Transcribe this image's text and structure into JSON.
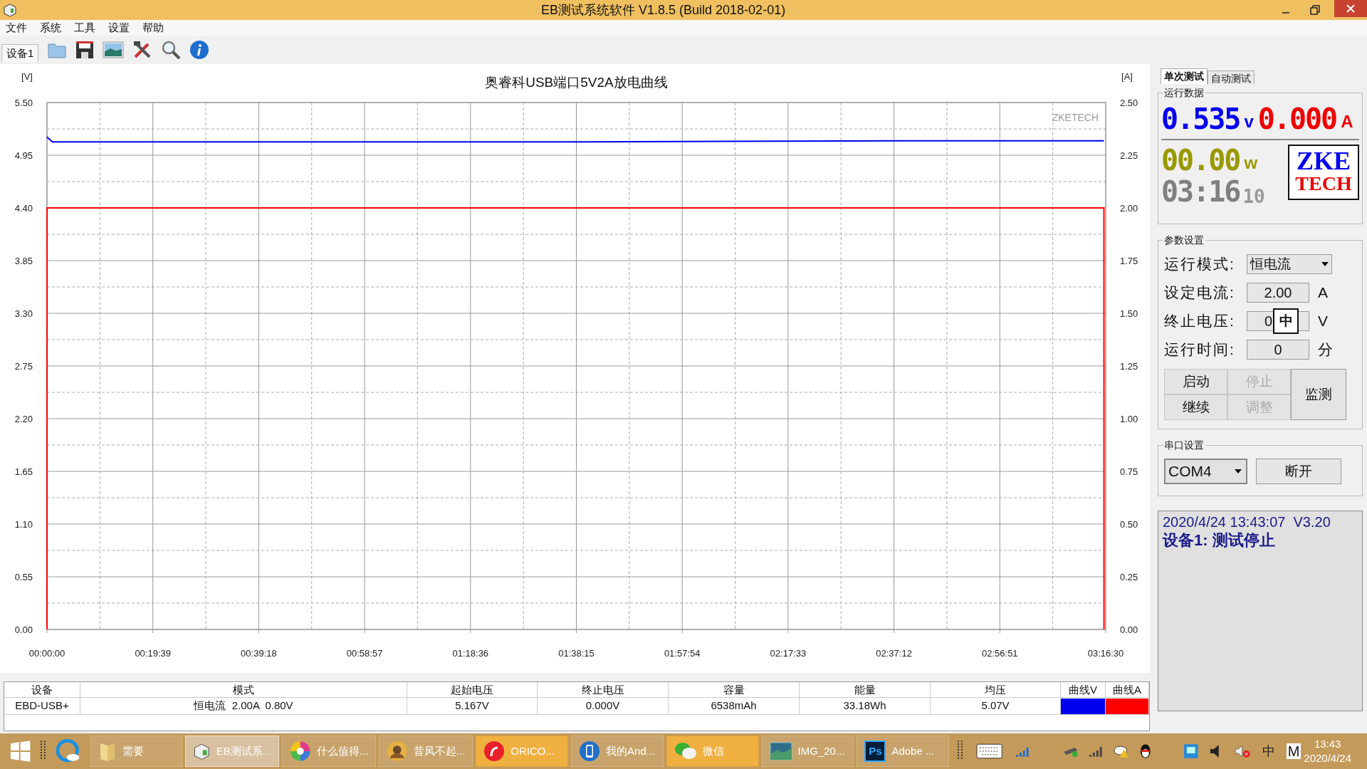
{
  "window": {
    "title": "EB测试系统软件 V1.8.5 (Build 2018-02-01)"
  },
  "menu": [
    "文件",
    "系统",
    "工具",
    "设置",
    "帮助"
  ],
  "toolbar": {
    "device_tab": "设备1",
    "tools": [
      {
        "kind": "folder"
      },
      {
        "kind": "save"
      },
      {
        "kind": "image"
      },
      {
        "kind": "tools"
      },
      {
        "kind": "search"
      },
      {
        "kind": "info"
      }
    ]
  },
  "chart_data": {
    "type": "line",
    "grid": true,
    "title": "奥睿科USB端口5V2A放电曲线",
    "ylabel": "[V]",
    "y2label": "[A]",
    "annotations": [
      "ZKETECH"
    ],
    "x": [
      0,
      1,
      60,
      300,
      6000,
      9500,
      11760,
      11770,
      11771
    ],
    "xlim": [
      0,
      11790
    ],
    "ylim": [
      0,
      5.5
    ],
    "y2lim": [
      0,
      2.5
    ],
    "xticks": [
      {
        "value": 0,
        "label": "00:00:00"
      },
      {
        "value": 1179,
        "label": "00:19:39"
      },
      {
        "value": 2358,
        "label": "00:39:18"
      },
      {
        "value": 3537,
        "label": "00:58:57"
      },
      {
        "value": 4716,
        "label": "01:18:36"
      },
      {
        "value": 5895,
        "label": "01:38:15"
      },
      {
        "value": 7074,
        "label": "01:57:54"
      },
      {
        "value": 8253,
        "label": "02:17:33"
      },
      {
        "value": 9432,
        "label": "02:37:12"
      },
      {
        "value": 10611,
        "label": "02:56:51"
      },
      {
        "value": 11790,
        "label": "03:16:30"
      }
    ],
    "yticks": [
      {
        "value": 0,
        "label": "0.00"
      },
      {
        "value": 0.55,
        "label": "0.55"
      },
      {
        "value": 1.1,
        "label": "1.10"
      },
      {
        "value": 1.65,
        "label": "1.65"
      },
      {
        "value": 2.2,
        "label": "2.20"
      },
      {
        "value": 2.75,
        "label": "2.75"
      },
      {
        "value": 3.3,
        "label": "3.30"
      },
      {
        "value": 3.85,
        "label": "3.85"
      },
      {
        "value": 4.4,
        "label": "4.40"
      },
      {
        "value": 4.95,
        "label": "4.95"
      },
      {
        "value": 5.5,
        "label": "5.50"
      }
    ],
    "y2ticks": [
      {
        "value": 0,
        "label": "0.00"
      },
      {
        "value": 0.25,
        "label": "0.25"
      },
      {
        "value": 0.5,
        "label": "0.50"
      },
      {
        "value": 0.75,
        "label": "0.75"
      },
      {
        "value": 1,
        "label": "1.00"
      },
      {
        "value": 1.25,
        "label": "1.25"
      },
      {
        "value": 1.5,
        "label": "1.50"
      },
      {
        "value": 1.75,
        "label": "1.75"
      },
      {
        "value": 2,
        "label": "2.00"
      },
      {
        "value": 2.25,
        "label": "2.25"
      },
      {
        "value": 2.5,
        "label": "2.50"
      }
    ],
    "series": [
      {
        "color": "#0000ee",
        "axis": "y",
        "values": [
          5.14,
          5.14,
          5.09,
          5.09,
          5.09,
          5.1,
          5.1,
          5.1,
          null
        ]
      },
      {
        "color": "#ff0000",
        "axis": "y2",
        "values": [
          0,
          2,
          2,
          2,
          2,
          2,
          2,
          2,
          0
        ]
      }
    ]
  },
  "side_tabs": [
    {
      "label": "单次测试",
      "selected": true
    },
    {
      "label": "自动测试",
      "selected": false
    }
  ],
  "run_data": {
    "title": "运行数据",
    "voltage": "0.535",
    "voltage_unit": "v",
    "current": "0.000",
    "current_unit": "A",
    "power": "00.00",
    "power_unit": "w",
    "time": "03:16",
    "seconds": "10",
    "logo_top": "ZKE",
    "logo_bottom": "TECH"
  },
  "params": {
    "title": "参数设置",
    "ime_indicator": "中",
    "rows": [
      {
        "label": "运行模式:",
        "value": "恒电流",
        "kind": "select"
      },
      {
        "label": "设定电流:",
        "value": "2.00",
        "unit": "A",
        "kind": "input"
      },
      {
        "label": "终止电压:",
        "value": "0",
        "unit": "V",
        "kind": "input"
      },
      {
        "label": "运行时间:",
        "value": "0",
        "unit": "分",
        "kind": "input"
      }
    ]
  },
  "buttons": [
    {
      "label": "启动",
      "disabled": false
    },
    {
      "label": "停止",
      "disabled": true
    },
    {
      "label": "继续",
      "disabled": false
    },
    {
      "label": "调整",
      "disabled": true
    }
  ],
  "monitor_button": "监测",
  "serial": {
    "title": "串口设置",
    "port": "COM4",
    "button": "断开"
  },
  "log": [
    "2020/4/24 13:43:07  V3.20",
    "设备1: 测试停止"
  ],
  "table": {
    "columns": [
      "设备",
      "模式",
      "起始电压",
      "终止电压",
      "容量",
      "能量",
      "均压",
      "曲线V",
      "曲线A"
    ],
    "rows": [
      {
        "cells": [
          "EBD-USB+",
          "恒电流  2.00A  0.80V",
          "5.167V",
          "0.000V",
          "6538mAh",
          "33.18Wh",
          "5.07V"
        ],
        "swatches": [
          {
            "color": "#0000ee"
          },
          {
            "color": "#ff0000"
          }
        ]
      }
    ]
  },
  "taskbar": {
    "apps": [
      {
        "label": "需要",
        "kind": "folder",
        "selected": false,
        "flashing": false
      },
      {
        "label": "EB测试系...",
        "kind": "device",
        "selected": true,
        "flashing": false
      },
      {
        "label": "什么值得...",
        "kind": "pinwheel",
        "selected": false,
        "flashing": false
      },
      {
        "label": "昔风不起...",
        "kind": "avatar",
        "selected": false,
        "flashing": false
      },
      {
        "label": "ORICO...",
        "kind": "red",
        "selected": false,
        "flashing": true
      },
      {
        "label": "我的And...",
        "kind": "phone",
        "selected": false,
        "flashing": false
      },
      {
        "label": "微信",
        "kind": "chat",
        "selected": false,
        "flashing": true
      },
      {
        "label": "IMG_20...",
        "kind": "photo",
        "selected": false,
        "flashing": false
      },
      {
        "label": "Adobe ...",
        "kind": "ps",
        "icon_text": "Ps",
        "selected": false,
        "flashing": false
      }
    ],
    "ime": "中",
    "ime_mode": "M",
    "time": "13:43",
    "date": "2020/4/24"
  }
}
